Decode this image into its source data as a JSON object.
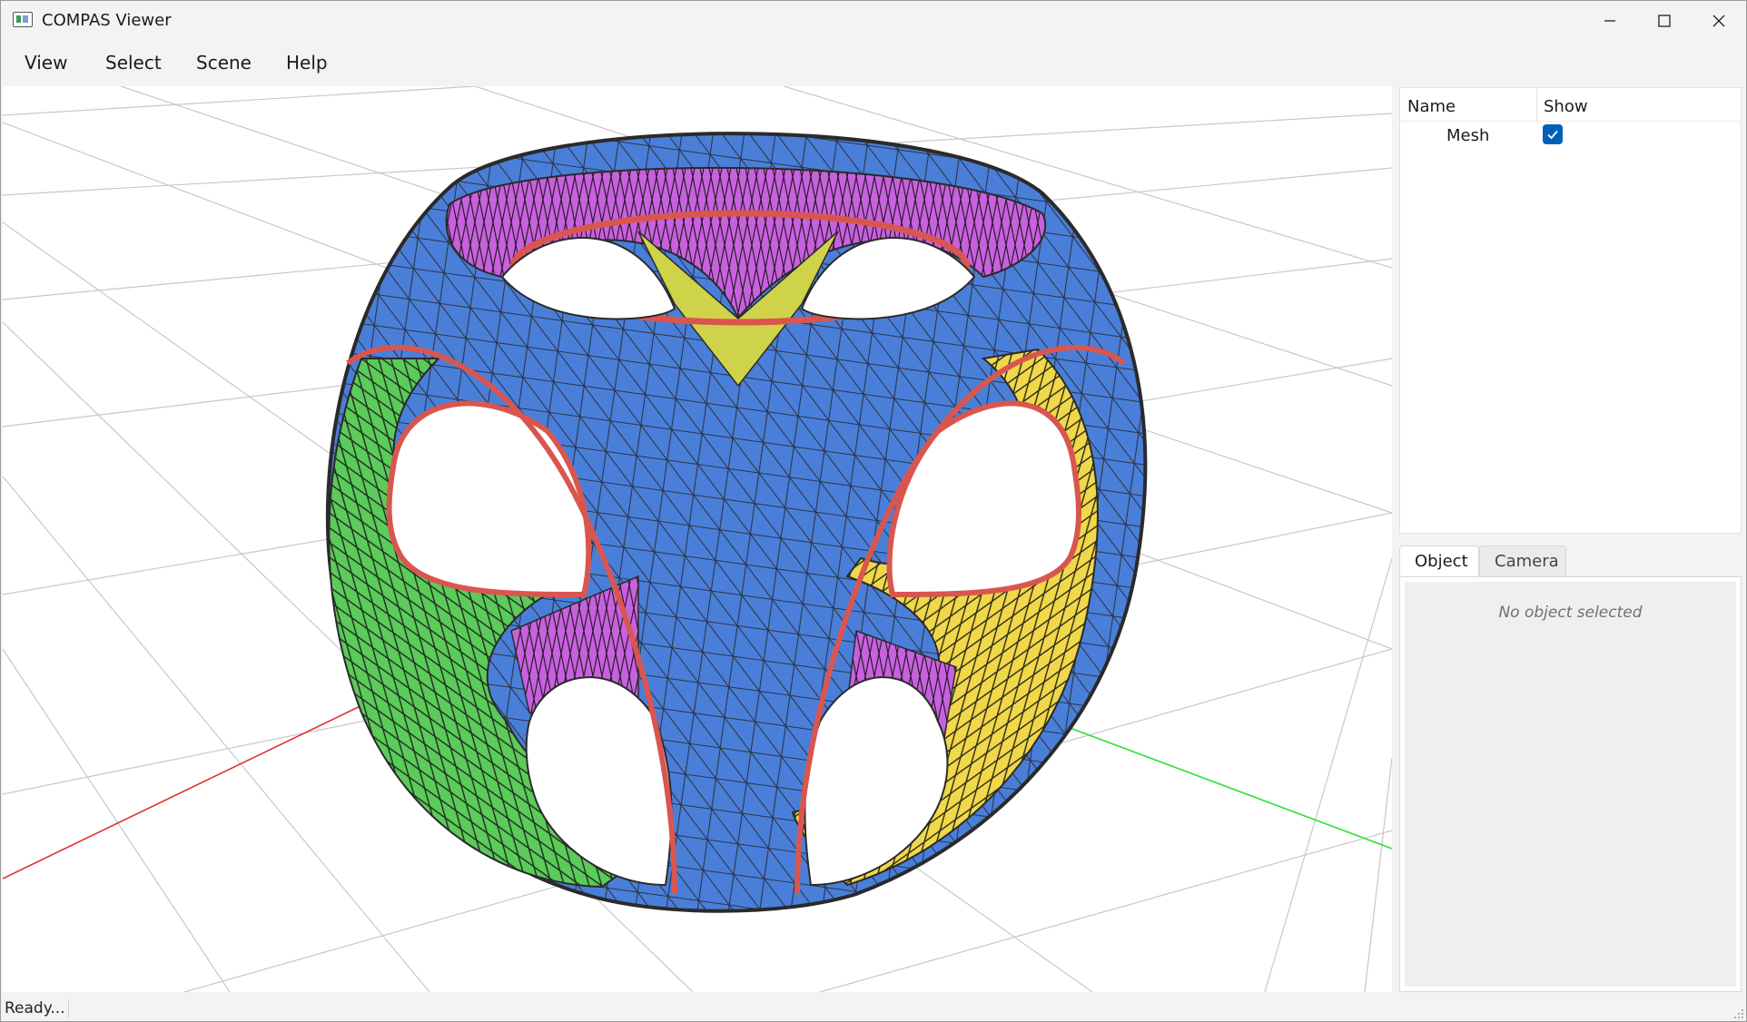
{
  "window": {
    "title": "COMPAS Viewer",
    "controls": {
      "minimize": "minimize-icon",
      "maximize": "maximize-icon",
      "close": "close-icon"
    }
  },
  "menu": {
    "items": [
      {
        "label": "View"
      },
      {
        "label": "Select"
      },
      {
        "label": "Scene"
      },
      {
        "label": "Help"
      }
    ]
  },
  "scene_tree": {
    "columns": {
      "name": "Name",
      "show": "Show"
    },
    "rows": [
      {
        "name": "Mesh",
        "show": true
      }
    ]
  },
  "properties": {
    "tabs": [
      {
        "label": "Object",
        "active": true
      },
      {
        "label": "Camera",
        "active": false
      }
    ],
    "empty_message": "No object selected"
  },
  "status": {
    "text": "Ready..."
  },
  "colors": {
    "accent": "#005fb8",
    "mesh_blue": "#4a7fd9",
    "mesh_green": "#5bcb5a",
    "mesh_yellow": "#f0d84a",
    "mesh_magenta": "#c861dd",
    "mesh_edge": "#d9564f",
    "axis_x": "#e03030",
    "axis_y": "#30e030",
    "grid": "#c8c8c8"
  }
}
